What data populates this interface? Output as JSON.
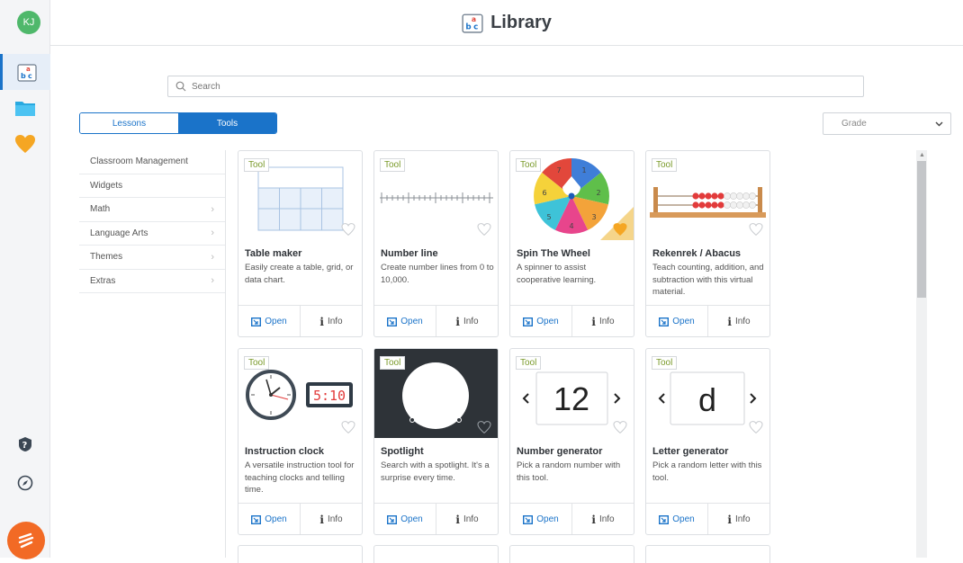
{
  "user": {
    "initials": "KJ"
  },
  "header": {
    "title": "Library"
  },
  "search": {
    "placeholder": "Search"
  },
  "tabs": {
    "lessons": "Lessons",
    "tools": "Tools"
  },
  "grade": {
    "label": "Grade"
  },
  "categories": [
    {
      "label": "Classroom Management",
      "chevron": false
    },
    {
      "label": "Widgets",
      "chevron": false
    },
    {
      "label": "Math",
      "chevron": true
    },
    {
      "label": "Language Arts",
      "chevron": true
    },
    {
      "label": "Themes",
      "chevron": true
    },
    {
      "label": "Extras",
      "chevron": true
    }
  ],
  "cards": [
    {
      "tag": "Tool",
      "title": "Table maker",
      "desc": "Easily create a table, grid, or data chart.",
      "open": "Open",
      "info": "Info",
      "favorited": false
    },
    {
      "tag": "Tool",
      "title": "Number line",
      "desc": "Create number lines from 0 to 10,000.",
      "open": "Open",
      "info": "Info",
      "favorited": false
    },
    {
      "tag": "Tool",
      "title": "Spin The Wheel",
      "desc": "A spinner to assist cooperative learning.",
      "open": "Open",
      "info": "Info",
      "favorited": true
    },
    {
      "tag": "Tool",
      "title": "Rekenrek / Abacus",
      "desc": "Teach counting, addition, and subtraction with this virtual material.",
      "open": "Open",
      "info": "Info",
      "favorited": false
    },
    {
      "tag": "Tool",
      "title": "Instruction clock",
      "desc": "A versatile instruction tool for teaching clocks and telling time.",
      "open": "Open",
      "info": "Info",
      "favorited": false,
      "digital": "5:10"
    },
    {
      "tag": "Tool",
      "title": "Spotlight",
      "desc": "Search with a spotlight. It's a surprise every time.",
      "open": "Open",
      "info": "Info",
      "favorited": false
    },
    {
      "tag": "Tool",
      "title": "Number generator",
      "desc": "Pick a random number with this tool.",
      "open": "Open",
      "info": "Info",
      "favorited": false,
      "display": "12"
    },
    {
      "tag": "Tool",
      "title": "Letter generator",
      "desc": "Pick a random letter with this tool.",
      "open": "Open",
      "info": "Info",
      "favorited": false,
      "display": "d"
    }
  ],
  "wheel": {
    "segments": [
      "1",
      "2",
      "3",
      "4",
      "5",
      "6",
      "7"
    ]
  },
  "colors": {
    "accent": "#1a73c9",
    "tag_text": "#7a9a2a",
    "favorite": "#f5a623",
    "avatar": "#4fb86b",
    "brand": "#f26a25"
  }
}
